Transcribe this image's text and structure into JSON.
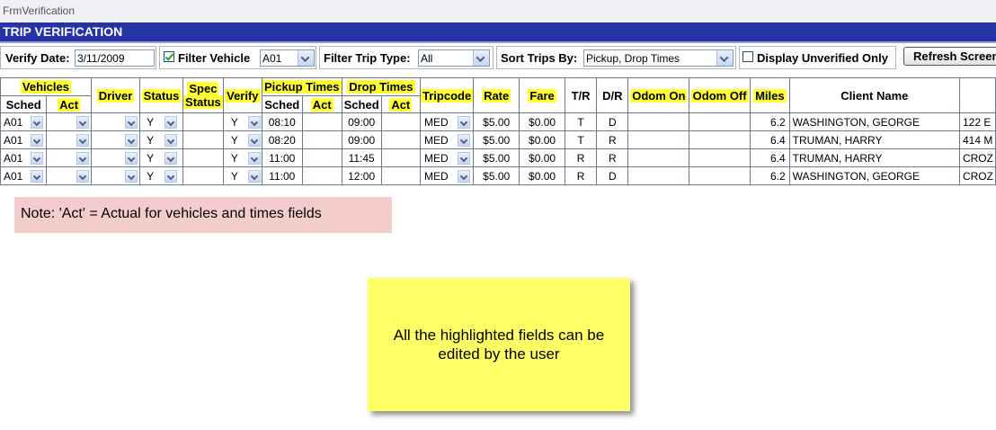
{
  "window": {
    "title": "FrmVerification"
  },
  "header": {
    "title": "TRIP VERIFICATION"
  },
  "toolbar": {
    "verify_date_label": "Verify Date:",
    "verify_date_value": "3/11/2009",
    "filter_vehicle_label": "Filter Vehicle",
    "filter_vehicle_checked": true,
    "filter_vehicle_value": "A01",
    "filter_trip_type_label": "Filter Trip Type:",
    "filter_trip_type_value": "All",
    "sort_label": "Sort Trips By:",
    "sort_value": "Pickup, Drop Times",
    "unverified_label": "Display Unverified Only",
    "unverified_checked": false,
    "refresh_label": "Refresh Screen"
  },
  "grid": {
    "headers": {
      "vehicles": "Vehicles",
      "sched": "Sched",
      "act": "Act",
      "driver": "Driver",
      "status": "Status",
      "spec_status_1": "Spec",
      "spec_status_2": "Status",
      "verify": "Verify",
      "pickup_times": "Pickup Times",
      "drop_times": "Drop Times",
      "tripcode": "Tripcode",
      "rate": "Rate",
      "fare": "Fare",
      "tr": "T/R",
      "dr": "D/R",
      "odom_on": "Odom On",
      "odom_off": "Odom Off",
      "miles": "Miles",
      "client_name": "Client Name"
    },
    "rows": [
      {
        "veh_sched": "A01",
        "status": "Y",
        "verify": "Y",
        "pickup_sched": "08:10",
        "drop_sched": "09:00",
        "tripcode": "MED",
        "rate": "$5.00",
        "fare": "$0.00",
        "tr": "T",
        "dr": "D",
        "miles": "6.2",
        "client": "WASHINGTON, GEORGE",
        "address": "122 E"
      },
      {
        "veh_sched": "A01",
        "status": "Y",
        "verify": "Y",
        "pickup_sched": "08:20",
        "drop_sched": "09:00",
        "tripcode": "MED",
        "rate": "$5.00",
        "fare": "$0.00",
        "tr": "T",
        "dr": "R",
        "miles": "6.4",
        "client": "TRUMAN, HARRY",
        "address": "414 M"
      },
      {
        "veh_sched": "A01",
        "status": "Y",
        "verify": "Y",
        "pickup_sched": "11:00",
        "drop_sched": "11:45",
        "tripcode": "MED",
        "rate": "$5.00",
        "fare": "$0.00",
        "tr": "R",
        "dr": "R",
        "miles": "6.4",
        "client": "TRUMAN, HARRY",
        "address": "CROZ"
      },
      {
        "veh_sched": "A01",
        "status": "Y",
        "verify": "Y",
        "pickup_sched": "11:00",
        "drop_sched": "12:00",
        "tripcode": "MED",
        "rate": "$5.00",
        "fare": "$0.00",
        "tr": "R",
        "dr": "D",
        "miles": "6.2",
        "client": "WASHINGTON, GEORGE",
        "address": "CROZ"
      }
    ]
  },
  "note": {
    "text": "Note:  'Act' = Actual for vehicles and times fields"
  },
  "sticky": {
    "line1": "All the highlighted fields can be",
    "line2": "edited by the user"
  },
  "colors": {
    "header_bg": "#2633a6",
    "highlight": "#ffff33",
    "note_bg": "#f5cccc",
    "sticky_bg": "#ffff66"
  }
}
